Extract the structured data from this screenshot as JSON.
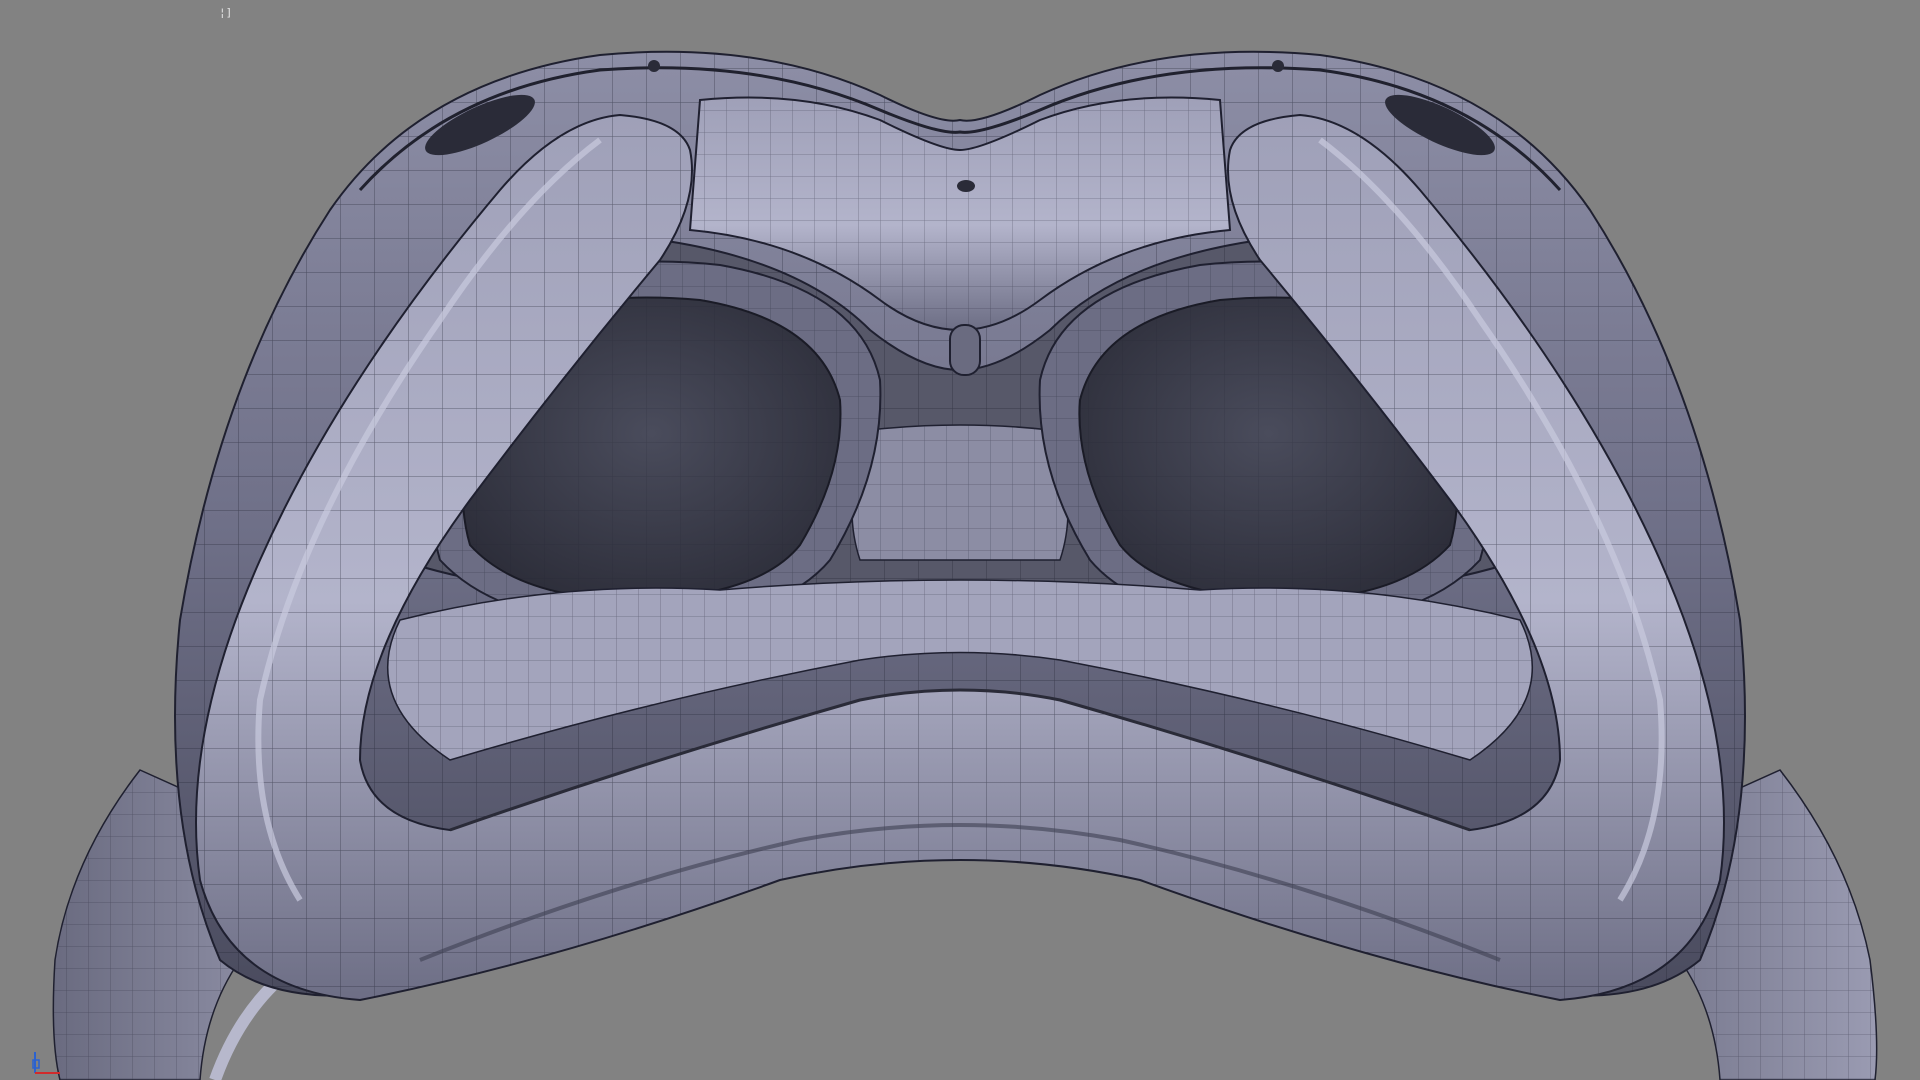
{
  "viewport": {
    "label": "¦]",
    "background": "#828282",
    "model": "vr-headset-face-interface",
    "shading": "smooth-with-wireframe",
    "colors": {
      "surface_light": "#a9aac0",
      "surface_mid": "#6f7088",
      "surface_dark": "#3a3b4c",
      "lens": "#3c3e4c",
      "wire": "#1f2030"
    }
  },
  "axis_gizmo": {
    "name": "axis-gizmo-icon",
    "x_color": "#d12b2b",
    "y_color": "#2b62d1"
  }
}
